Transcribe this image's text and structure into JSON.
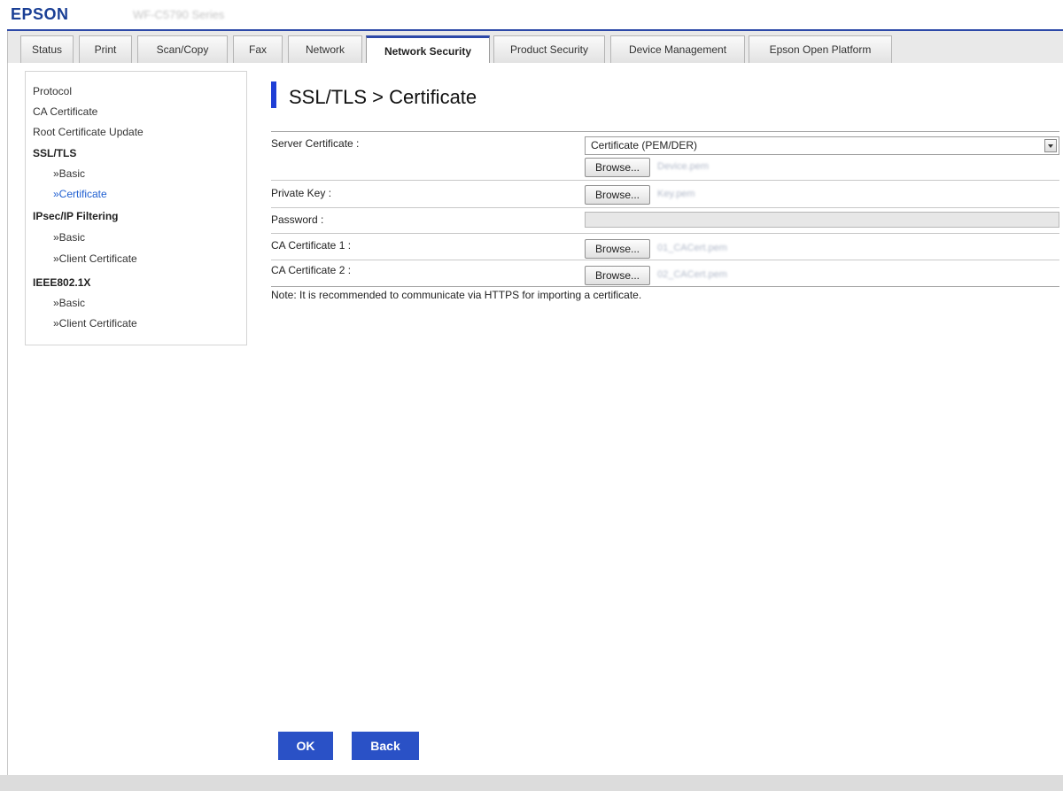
{
  "header": {
    "brand": "EPSON",
    "model": "WF-C5790 Series"
  },
  "tabs": [
    {
      "label": "Status",
      "active": false
    },
    {
      "label": "Print",
      "active": false
    },
    {
      "label": "Scan/Copy",
      "active": false
    },
    {
      "label": "Fax",
      "active": false
    },
    {
      "label": "Network",
      "active": false
    },
    {
      "label": "Network Security",
      "active": true
    },
    {
      "label": "Product Security",
      "active": false
    },
    {
      "label": "Device Management",
      "active": false
    },
    {
      "label": "Epson Open Platform",
      "active": false
    }
  ],
  "sidebar": {
    "protocol": "Protocol",
    "ca_certificate": "CA Certificate",
    "root_certificate_update": "Root Certificate Update",
    "ssl_tls": "SSL/TLS",
    "ssl_basic": "»Basic",
    "ssl_certificate": "»Certificate",
    "ipsec": "IPsec/IP Filtering",
    "ipsec_basic": "»Basic",
    "ipsec_client_certificate": "»Client Certificate",
    "ieee": "IEEE802.1X",
    "ieee_basic": "»Basic",
    "ieee_client_certificate": "»Client Certificate"
  },
  "main": {
    "title": "SSL/TLS > Certificate",
    "server_certificate_label": "Server Certificate :",
    "server_certificate_format": "Certificate (PEM/DER)",
    "server_certificate_file": "Device.pem",
    "private_key_label": "Private Key :",
    "private_key_file": "Key.pem",
    "password_label": "Password :",
    "ca_certificate_1_label": "CA Certificate 1 :",
    "ca_certificate_1_file": "01_CACert.pem",
    "ca_certificate_2_label": "CA Certificate 2 :",
    "ca_certificate_2_file": "02_CACert.pem",
    "browse_label": "Browse...",
    "note": "Note: It is recommended to communicate via HTTPS for importing a certificate."
  },
  "buttons": {
    "ok": "OK",
    "back": "Back"
  },
  "colors": {
    "brand_blue": "#1a3f95",
    "accent_blue": "#2a51c6",
    "active_link": "#1f5fd1"
  }
}
